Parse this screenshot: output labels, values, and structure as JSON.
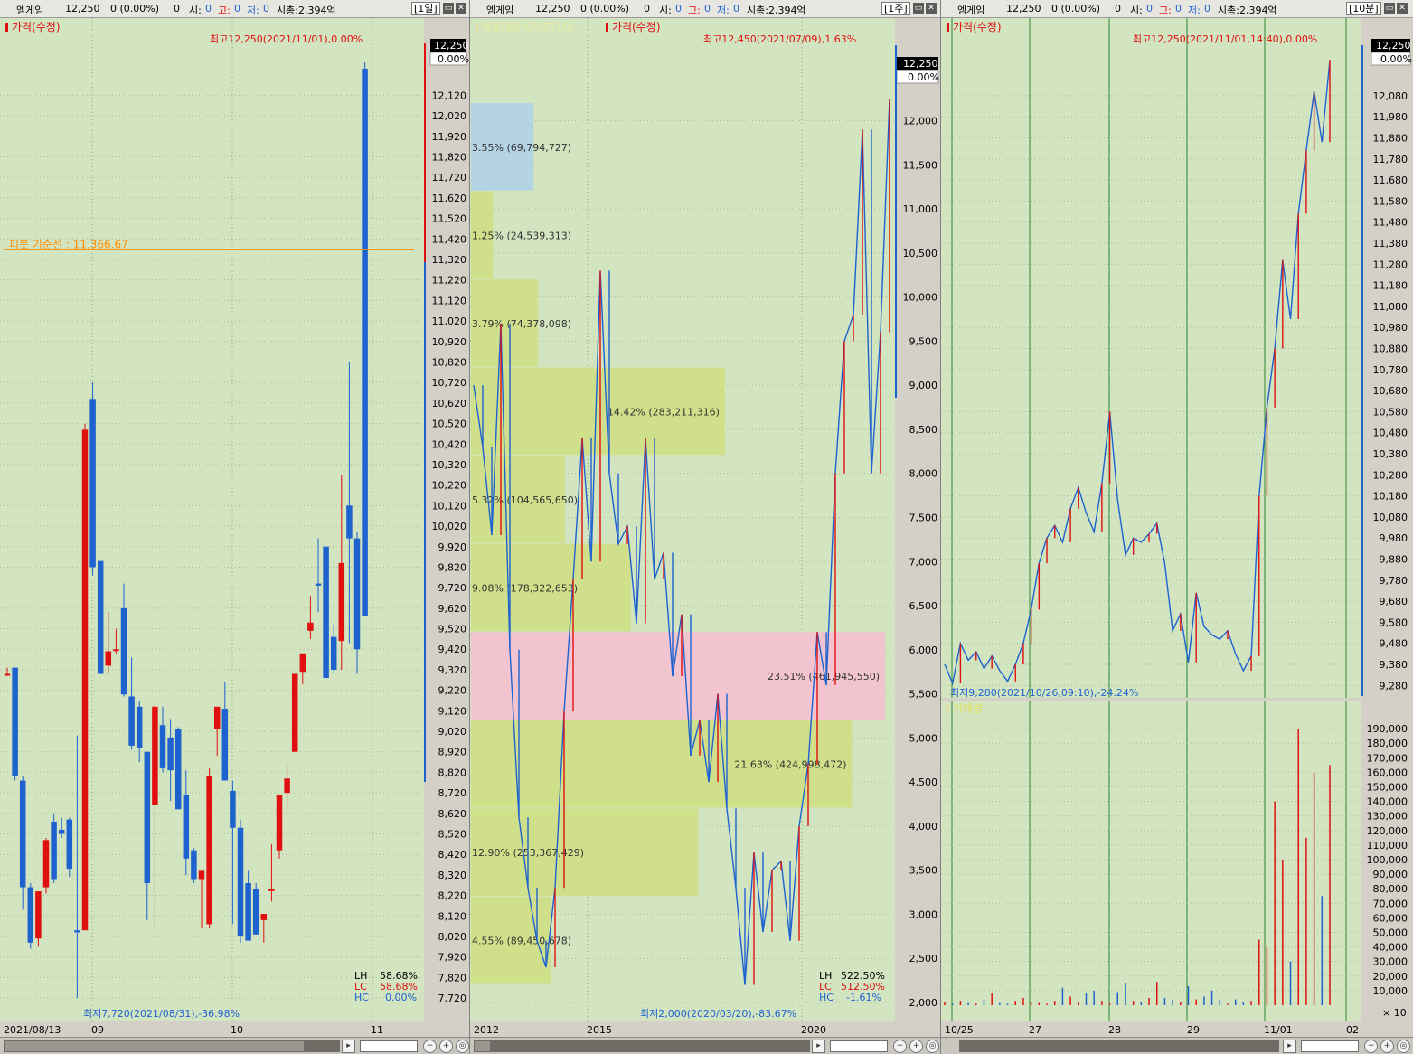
{
  "header": {
    "stock": "엠게임",
    "price": "12,250",
    "change": "0 (0.00%)",
    "volume": "0",
    "open_label": "시:",
    "open": "0",
    "high_label": "고:",
    "high": "0",
    "low_label": "저:",
    "low": "0",
    "market_cap": "시총:2,394억"
  },
  "panels": [
    {
      "timeframe": "[1일]",
      "legend": "가격(수정)",
      "pivot_label": "피봇 기준선 : 11,366.67",
      "high_note": "최고12,250(2021/11/01),0.00%",
      "low_note": "최저7,720(2021/08/31),-36.98%",
      "current_price": "12,250",
      "current_pct": "0.00%",
      "stats": [
        {
          "k": "LH",
          "v": "58.68%"
        },
        {
          "k": "LC",
          "v": "58.68%"
        },
        {
          "k": "HC",
          "v": "0.00%"
        }
      ],
      "x_labels": [
        "2021/08/13",
        "09",
        "10",
        "11"
      ]
    },
    {
      "timeframe": "[1주]",
      "legend": "가격(수정)",
      "profile_legend": "매물대분석차트(10)",
      "high_note": "최고12,450(2021/07/09),1.63%",
      "low_note": "최저2,000(2020/03/20),-83.67%",
      "current_price": "12,250",
      "current_pct": "0.00%",
      "stats": [
        {
          "k": "LH",
          "v": "522.50%"
        },
        {
          "k": "LC",
          "v": "512.50%"
        },
        {
          "k": "HC",
          "v": "-1.61%"
        }
      ],
      "x_labels": [
        "2012",
        "2015",
        "2020"
      ]
    },
    {
      "timeframe": "[10분]",
      "legend": "가격(수정)",
      "volume_legend": "거래량",
      "high_note": "최고12,250(2021/11/01,14:40),0.00%",
      "low_note": "최저9,280(2021/10/26,09:10),-24.24%",
      "current_price": "12,250",
      "current_pct": "0.00%",
      "volume_unit": "× 10",
      "x_labels": [
        "10/25",
        "27",
        "28",
        "29",
        "11/01",
        "02"
      ]
    }
  ],
  "chart_data": [
    {
      "type": "candlestick",
      "title": "",
      "period": "daily",
      "ylim": [
        7650,
        12320
      ],
      "y_ticks": [
        7720,
        7820,
        7920,
        8020,
        8120,
        8220,
        8320,
        8420,
        8520,
        8620,
        8720,
        8820,
        8920,
        9020,
        9120,
        9220,
        9320,
        9420,
        9520,
        9620,
        9720,
        9820,
        9920,
        10020,
        10120,
        10220,
        10320,
        10420,
        10520,
        10620,
        10720,
        10820,
        10920,
        11020,
        11120,
        11220,
        11320,
        11420,
        11520,
        11620,
        11720,
        11820,
        11920,
        12020,
        12120
      ],
      "pivot": 11366.67,
      "candles": [
        [
          9300,
          9330,
          9290,
          9300
        ],
        [
          9330,
          9330,
          8780,
          8800
        ],
        [
          8780,
          8800,
          8150,
          8260
        ],
        [
          8260,
          8280,
          7960,
          7990
        ],
        [
          8010,
          8230,
          7970,
          8240
        ],
        [
          8260,
          8500,
          8230,
          8490
        ],
        [
          8580,
          8620,
          8280,
          8300
        ],
        [
          8540,
          8600,
          8500,
          8520
        ],
        [
          8590,
          8600,
          8310,
          8350
        ],
        [
          8050,
          9000,
          7720,
          8040
        ],
        [
          8050,
          10520,
          8050,
          10490
        ],
        [
          10640,
          10720,
          9780,
          9820
        ],
        [
          9850,
          9850,
          9300,
          9300
        ],
        [
          9340,
          9600,
          9300,
          9410
        ],
        [
          9420,
          9520,
          9400,
          9420
        ],
        [
          9620,
          9740,
          9190,
          9200
        ],
        [
          9190,
          9380,
          8930,
          8950
        ],
        [
          9140,
          9170,
          8870,
          8940
        ],
        [
          8920,
          8920,
          8100,
          8280
        ],
        [
          8660,
          9170,
          8050,
          9140
        ],
        [
          9050,
          9140,
          8820,
          8840
        ],
        [
          8990,
          9080,
          8680,
          8830
        ],
        [
          9030,
          9040,
          8660,
          8640
        ],
        [
          8710,
          8830,
          8320,
          8400
        ],
        [
          8440,
          8450,
          8280,
          8300
        ],
        [
          8300,
          8320,
          8060,
          8340
        ],
        [
          8080,
          8840,
          8060,
          8800
        ],
        [
          9030,
          9050,
          8900,
          9140
        ],
        [
          9130,
          9260,
          8780,
          8780
        ],
        [
          8730,
          8780,
          8080,
          8550
        ],
        [
          8550,
          8590,
          7990,
          8020
        ],
        [
          8280,
          8340,
          8140,
          8000
        ],
        [
          8250,
          8280,
          8030,
          8030
        ],
        [
          8100,
          8130,
          7990,
          8130
        ],
        [
          8250,
          8470,
          8190,
          8250
        ],
        [
          8440,
          8700,
          8400,
          8710
        ],
        [
          8720,
          8860,
          8640,
          8790
        ],
        [
          8920,
          9300,
          8920,
          9300
        ],
        [
          9310,
          9350,
          9250,
          9400
        ],
        [
          9510,
          9680,
          9470,
          9550
        ],
        [
          9740,
          9960,
          9600,
          9730
        ],
        [
          9920,
          9800,
          9300,
          9280
        ],
        [
          9480,
          9540,
          9300,
          9320
        ],
        [
          9460,
          10270,
          9320,
          9840
        ],
        [
          10120,
          10820,
          9450,
          9960
        ],
        [
          9960,
          9990,
          9300,
          9420
        ],
        [
          12250,
          12280,
          9580,
          9580
        ]
      ]
    },
    {
      "type": "line",
      "title": "",
      "period": "weekly",
      "ylim": [
        2000,
        12600
      ],
      "y_ticks": [
        2000,
        2500,
        3000,
        3500,
        4000,
        4500,
        5000,
        5500,
        6000,
        6500,
        7000,
        7500,
        8000,
        8500,
        9000,
        9500,
        10000,
        10500,
        11000,
        11500,
        12000
      ],
      "series": [
        {
          "values": [
            9000,
            8300,
            7300,
            9700,
            6000,
            4100,
            3300,
            2700,
            2400,
            3300,
            5300,
            6800,
            8400,
            7000,
            10300,
            8000,
            7200,
            7400,
            6300,
            8400,
            6800,
            7100,
            5700,
            6400,
            4800,
            5200,
            4500,
            5500,
            4200,
            3300,
            2200,
            3700,
            2800,
            3500,
            3600,
            2700,
            4000,
            4700,
            6200,
            5600,
            8000,
            9500,
            9800,
            11900,
            8000,
            9600,
            12250
          ]
        }
      ],
      "volume_profile": [
        {
          "low": 2200,
          "high": 3200,
          "pct": "4.55%",
          "volume": "89,450,678"
        },
        {
          "low": 3200,
          "high": 4200,
          "pct": "12.90%",
          "volume": "253,367,429"
        },
        {
          "low": 4200,
          "high": 5200,
          "pct": "21.63%",
          "volume": "424,998,472"
        },
        {
          "low": 5200,
          "high": 6200,
          "pct": "23.51%",
          "volume": "461,945,550"
        },
        {
          "low": 6200,
          "high": 7200,
          "pct": "9.08%",
          "volume": "178,322,653"
        },
        {
          "low": 7200,
          "high": 8200,
          "pct": "5.32%",
          "volume": "104,565,650"
        },
        {
          "low": 8200,
          "high": 9200,
          "pct": "14.42%",
          "volume": "283,211,316"
        },
        {
          "low": 9200,
          "high": 10200,
          "pct": "3.79%",
          "volume": "74,378,098"
        },
        {
          "low": 10200,
          "high": 11200,
          "pct": "1.25%",
          "volume": "24,539,313"
        },
        {
          "low": 11200,
          "high": 12200,
          "pct": "3.55%",
          "volume": "69,794,727"
        }
      ]
    },
    {
      "type": "line",
      "title": "",
      "period": "10-minute",
      "ylim": [
        9230,
        12320
      ],
      "y_ticks": [
        9280,
        9380,
        9480,
        9580,
        9680,
        9780,
        9880,
        9980,
        10080,
        10180,
        10280,
        10380,
        10480,
        10580,
        10680,
        10780,
        10880,
        10980,
        11080,
        11180,
        11280,
        11380,
        11480,
        11580,
        11680,
        11780,
        11880,
        11980,
        12080
      ],
      "series": [
        {
          "values": [
            9380,
            9290,
            9480,
            9400,
            9440,
            9360,
            9420,
            9350,
            9300,
            9380,
            9480,
            9640,
            9860,
            9980,
            10040,
            9960,
            10120,
            10220,
            10100,
            10010,
            10240,
            10580,
            10160,
            9900,
            9980,
            9960,
            10000,
            10050,
            9860,
            9540,
            9620,
            9390,
            9720,
            9560,
            9520,
            9500,
            9540,
            9430,
            9350,
            9420,
            10180,
            10600,
            10880,
            11300,
            11020,
            11520,
            11820,
            12100,
            11860,
            12250
          ]
        }
      ],
      "volume": {
        "unit": "×10",
        "y_ticks": [
          10000,
          20000,
          30000,
          40000,
          50000,
          60000,
          70000,
          80000,
          90000,
          100000,
          110000,
          120000,
          130000,
          140000,
          150000,
          160000,
          170000,
          180000,
          190000
        ],
        "values": [
          2000,
          1000,
          3000,
          1500,
          1000,
          4000,
          8000,
          1500,
          1000,
          3000,
          5000,
          2000,
          1500,
          1000,
          3000,
          12000,
          6000,
          2000,
          8000,
          10000,
          3000,
          1000,
          9000,
          15000,
          3000,
          2000,
          5000,
          16000,
          5000,
          4000,
          2000,
          13000,
          4000,
          6000,
          10000,
          4000,
          1000,
          4000,
          2000,
          3000,
          45000,
          40000,
          140000,
          100000,
          30000,
          190000,
          115000,
          160000,
          75000,
          165000
        ]
      }
    }
  ],
  "colors": {
    "up": "#e01010",
    "down": "#1e62d0",
    "plot_bg": "#d2e4c0",
    "pivot": "#ff8c00",
    "profile_default": "#d0e08a",
    "profile_current": "#f2c4cf",
    "profile_high": "#b4d3e4"
  }
}
